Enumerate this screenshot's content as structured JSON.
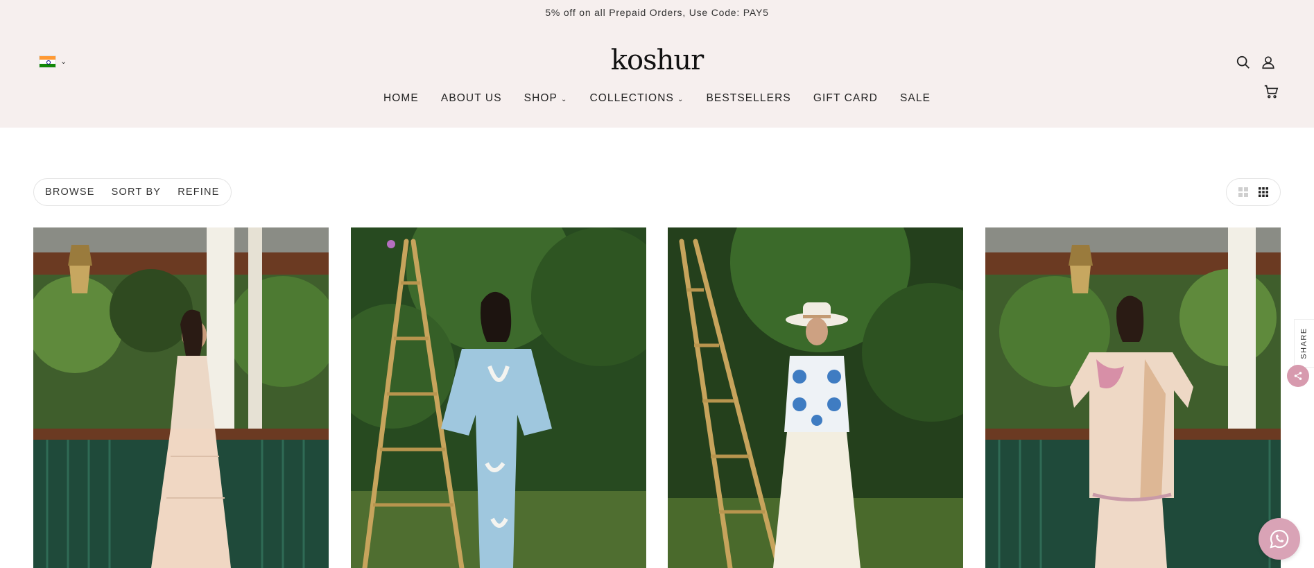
{
  "announcement": {
    "text": "5% off on all Prepaid Orders, Use Code: PAY5"
  },
  "header": {
    "logo": "koshur",
    "country_chevron": "⌄",
    "icons": [
      "search-icon",
      "user-icon",
      "cart-icon"
    ]
  },
  "nav": {
    "items": [
      {
        "label": "HOME"
      },
      {
        "label": "ABOUT US"
      },
      {
        "label": "SHOP",
        "has_dropdown": true
      },
      {
        "label": "COLLECTIONS",
        "has_dropdown": true
      },
      {
        "label": "BESTSELLERS"
      },
      {
        "label": "GIFT CARD"
      },
      {
        "label": "SALE"
      }
    ],
    "chevron": "⌄"
  },
  "toolbar": {
    "browse": "BROWSE",
    "sort_by": "SORT BY",
    "refine": "REFINE"
  },
  "view_toggle": {
    "icons": [
      "grid-2-icon",
      "grid-4-icon"
    ],
    "active": "grid-4-icon"
  },
  "share": {
    "label": "SHARE"
  },
  "colors": {
    "header_bg": "#f6efee",
    "accent_pink": "#d9a3b6",
    "text": "#222222"
  }
}
